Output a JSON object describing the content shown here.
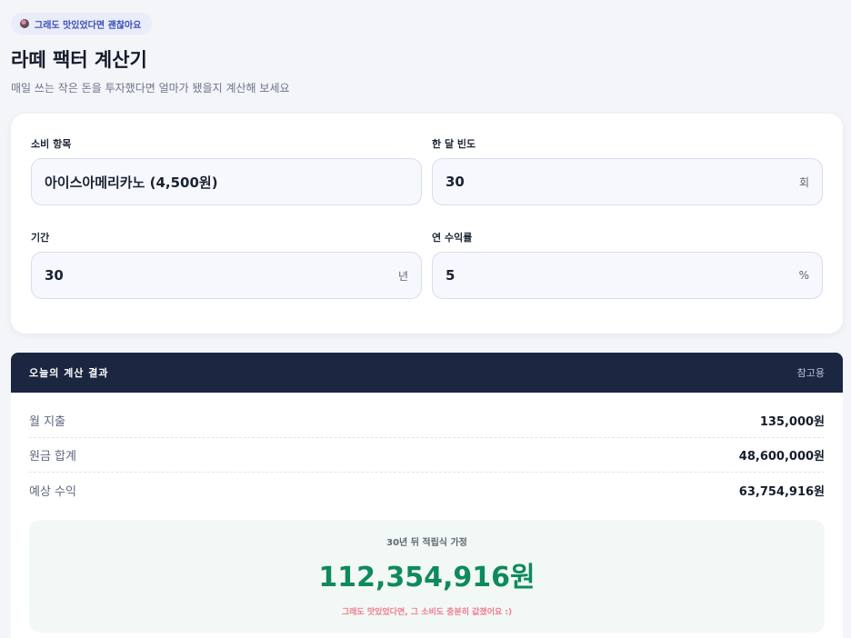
{
  "badge": {
    "text": "그래도 맛있었다면 괜찮아요"
  },
  "page": {
    "title": "라떼 팩터 계산기",
    "subtitle": "매일 쓰는 작은 돈을 투자했다면 얼마가 됐을지 계산해 보세요"
  },
  "form": {
    "item": {
      "label": "소비 항목",
      "value": "아이스아메리카노 (4,500원)"
    },
    "frequency": {
      "label": "한 달 빈도",
      "value": "30",
      "unit": "회"
    },
    "period": {
      "label": "기간",
      "value": "30",
      "unit": "년"
    },
    "rate": {
      "label": "연 수익률",
      "value": "5",
      "unit": "%"
    }
  },
  "result": {
    "title": "오늘의 계산 결과",
    "ref": "참고용",
    "rows": [
      {
        "label": "월 지출",
        "value": "135,000원"
      },
      {
        "label": "원금 합계",
        "value": "48,600,000원"
      },
      {
        "label": "예상 수익",
        "value": "63,754,916원"
      }
    ],
    "summary": {
      "caption": "30년 뒤 적립식 가정",
      "amount": "112,354,916원",
      "note": "그래도 맛있었다면, 그 소비도 충분히 값졌어요 :)"
    }
  },
  "colors": {
    "accent": "#3a4fb8",
    "header": "#1b2640",
    "positive": "#0f8a5c",
    "note": "#f07a8f"
  }
}
